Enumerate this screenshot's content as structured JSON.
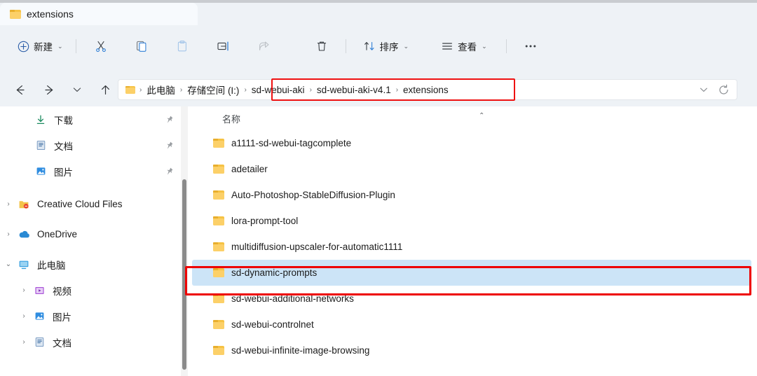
{
  "window": {
    "tab_title": "extensions",
    "tab_icon": "folder-icon"
  },
  "toolbar": {
    "new_label": "新建",
    "new_icon": "plus-circle-icon",
    "cut_icon": "scissors-icon",
    "copy_icon": "copy-icon",
    "paste_icon": "paste-icon",
    "rename_icon": "rename-icon",
    "share_icon": "share-icon",
    "delete_icon": "trash-icon",
    "sort_label": "排序",
    "sort_icon": "sort-arrows-icon",
    "view_label": "查看",
    "view_icon": "view-lines-icon",
    "more_label": "···",
    "more_icon": "ellipsis-icon"
  },
  "nav": {
    "back_icon": "arrow-left-icon",
    "forward_icon": "arrow-right-icon",
    "recent_icon": "chevron-down-icon",
    "up_icon": "arrow-up-icon",
    "dropdown_icon": "chevron-down-icon",
    "refresh_icon": "refresh-icon"
  },
  "breadcrumb": {
    "root_icon": "folder-icon",
    "items": [
      "此电脑",
      "存储空间 (I:)",
      "sd-webui-aki",
      "sd-webui-aki-v4.1",
      "extensions"
    ],
    "separator": "›"
  },
  "sidebar": {
    "items": [
      {
        "label": "下载",
        "icon": "download-icon",
        "chevron": "",
        "pinned": true,
        "indent": 0
      },
      {
        "label": "文档",
        "icon": "document-icon",
        "chevron": "",
        "pinned": true,
        "indent": 0
      },
      {
        "label": "图片",
        "icon": "picture-icon",
        "chevron": "",
        "pinned": true,
        "indent": 0
      },
      {
        "label": "Creative Cloud Files",
        "icon": "creative-cloud-icon",
        "chevron": "›",
        "pinned": false,
        "indent": 1
      },
      {
        "label": "OneDrive",
        "icon": "onedrive-cloud-icon",
        "chevron": "›",
        "pinned": false,
        "indent": 1
      },
      {
        "label": "此电脑",
        "icon": "this-pc-icon",
        "chevron": "⌄",
        "pinned": false,
        "indent": 1
      },
      {
        "label": "视频",
        "icon": "video-icon",
        "chevron": "›",
        "pinned": false,
        "indent": 2
      },
      {
        "label": "图片",
        "icon": "picture-icon",
        "chevron": "›",
        "pinned": false,
        "indent": 2
      },
      {
        "label": "文档",
        "icon": "document-icon",
        "chevron": "›",
        "pinned": false,
        "indent": 2
      }
    ]
  },
  "filelist": {
    "column_header": "名称",
    "sort_indicator": "⌃",
    "rows": [
      {
        "name": "a1111-sd-webui-tagcomplete",
        "selected": false
      },
      {
        "name": "adetailer",
        "selected": false
      },
      {
        "name": "Auto-Photoshop-StableDiffusion-Plugin",
        "selected": false
      },
      {
        "name": "lora-prompt-tool",
        "selected": false
      },
      {
        "name": "multidiffusion-upscaler-for-automatic1111",
        "selected": false
      },
      {
        "name": "sd-dynamic-prompts",
        "selected": true
      },
      {
        "name": "sd-webui-additional-networks",
        "selected": false
      },
      {
        "name": "sd-webui-controlnet",
        "selected": false
      },
      {
        "name": "sd-webui-infinite-image-browsing",
        "selected": false
      }
    ]
  },
  "annotations": {
    "highlight_color": "#ee0000",
    "breadcrumb_box": "sd-webui-aki › sd-webui-aki-v4.1 › extensions",
    "row_box": "sd-dynamic-prompts"
  },
  "colors": {
    "window_bg": "#eef2f6",
    "pane_bg": "#ffffff",
    "selection_bg": "#cce4f7",
    "accent": "#0067c0"
  }
}
